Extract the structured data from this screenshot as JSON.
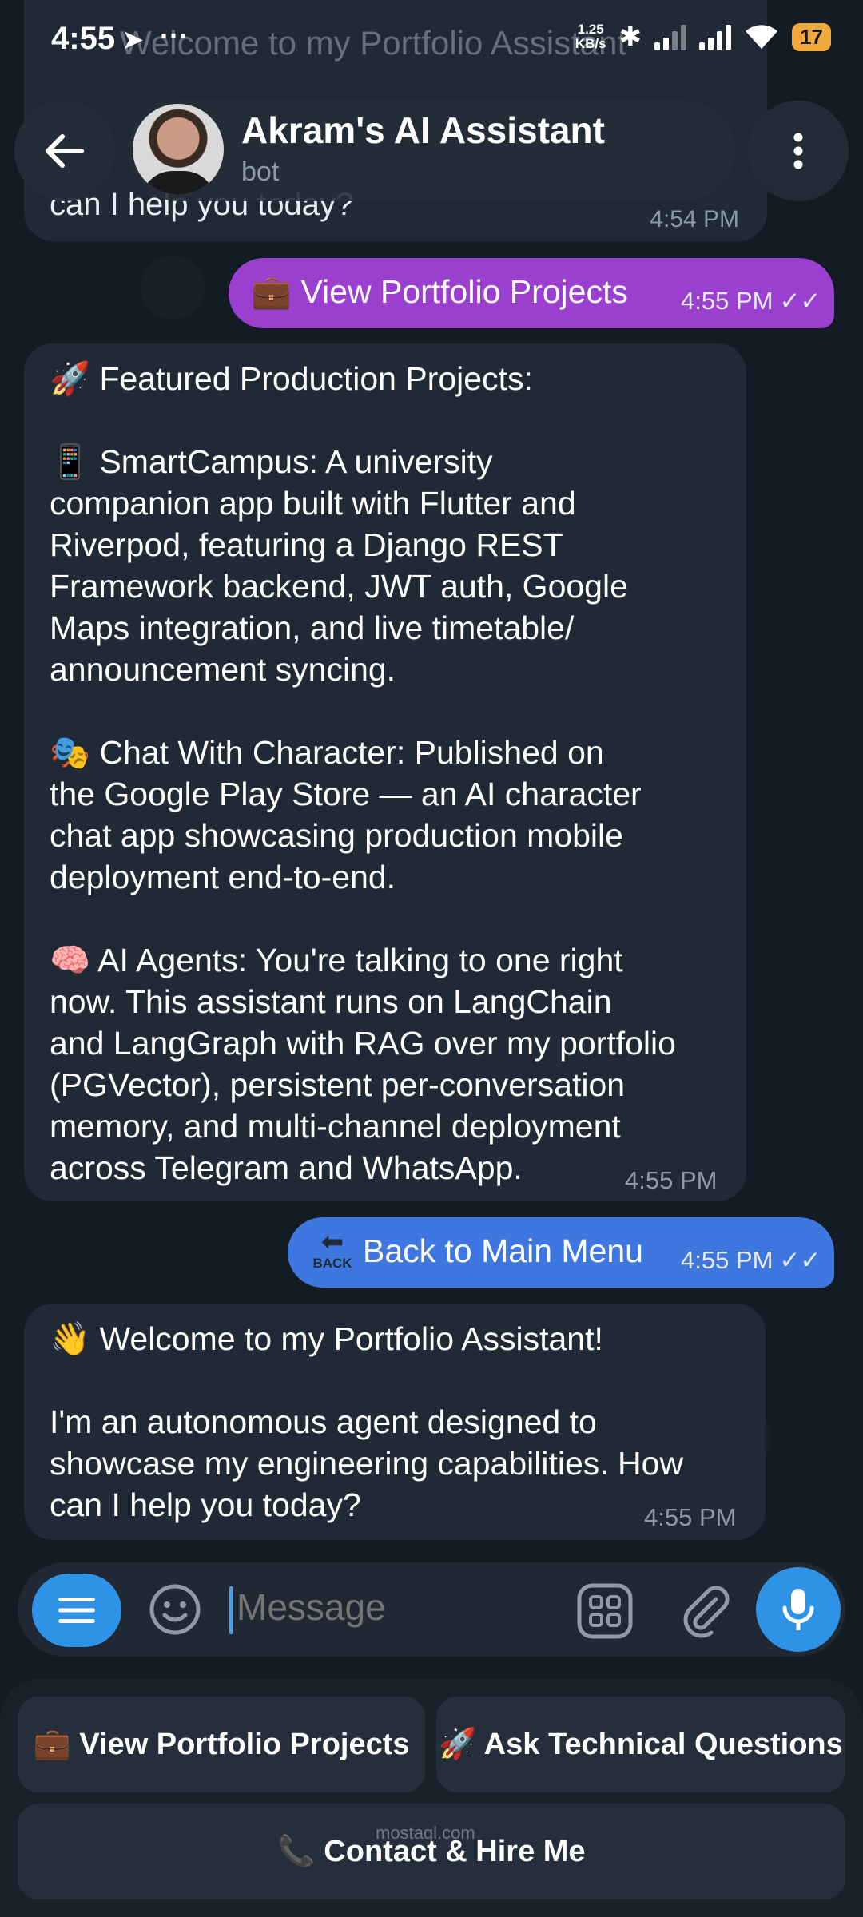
{
  "status_bar": {
    "time": "4:55",
    "net_speed_value": "1.25",
    "net_speed_unit": "KB/s",
    "battery": "17"
  },
  "header": {
    "title": "Akram's AI Assistant",
    "subtitle": "bot"
  },
  "ghost": {
    "title_text": "Welcome to my Portfolio Assistant",
    "last_line": "can I help you today?",
    "time": "4:54 PM"
  },
  "messages": [
    {
      "direction": "out",
      "text": "💼 View Portfolio Projects",
      "time": "4:55 PM",
      "color": "#9b3fce"
    },
    {
      "direction": "in",
      "text": "🚀 Featured Production Projects:\n\n📱 SmartCampus: A university\ncompanion app built with Flutter and\nRiverpod, featuring a Django REST\nFramework backend, JWT auth, Google\nMaps integration, and live timetable/\nannouncement syncing.\n\n🎭 Chat With Character: Published on\nthe Google Play Store — an AI character\nchat app showcasing production mobile\ndeployment end-to-end.\n\n🧠 AI Agents: You're talking to one right\nnow. This assistant runs on LangChain\nand LangGraph with RAG over my portfolio\n(PGVector), persistent per-conversation\nmemory, and multi-channel deployment\nacross Telegram and WhatsApp.",
      "time": "4:55 PM"
    },
    {
      "direction": "out",
      "icon_text": "BACK",
      "text": "Back to Main Menu",
      "time": "4:55 PM",
      "color": "#3f77e0"
    },
    {
      "direction": "in",
      "text": "👋 Welcome to my Portfolio Assistant!\n\nI'm an autonomous agent designed to\nshowcase my engineering capabilities. How\ncan I help you today?",
      "time": "4:55 PM"
    }
  ],
  "composer": {
    "placeholder": "Message"
  },
  "keyboard": {
    "buttons": [
      {
        "label": "💼 View Portfolio Projects"
      },
      {
        "label": "🚀 Ask Technical Questions"
      },
      {
        "label": "📞 Contact & Hire Me"
      }
    ]
  },
  "watermark": {
    "text": "mostaql.com"
  },
  "colors": {
    "accent": "#2e93e6",
    "incoming_bubble": "#202a36",
    "background": "#131b24"
  }
}
